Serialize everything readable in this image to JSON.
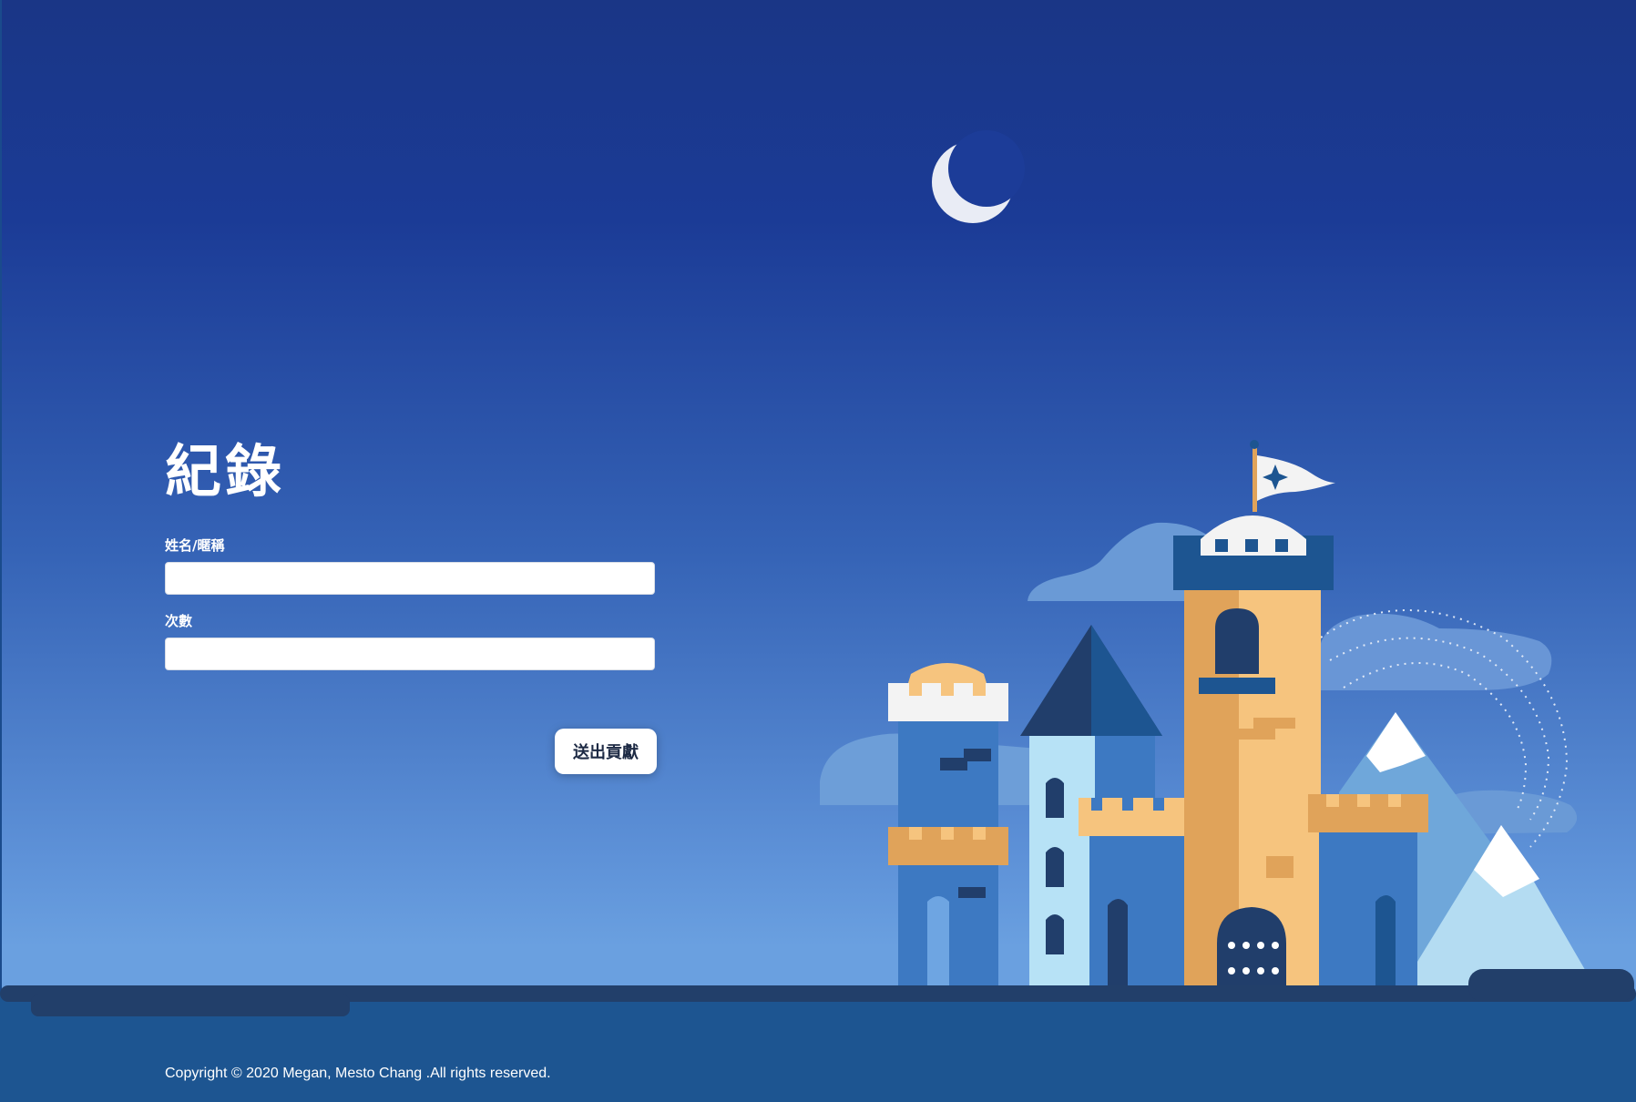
{
  "page": {
    "title": "紀錄"
  },
  "form": {
    "name_label": "姓名/暱稱",
    "name_value": "",
    "count_label": "次數",
    "count_value": "",
    "submit_label": "送出貢獻"
  },
  "footer": {
    "copyright": "Copyright © 2020 Megan, Mesto Chang .All rights reserved."
  },
  "colors": {
    "sky_top": "#1a3686",
    "sky_bottom": "#6aa0e0",
    "ground": "#1d5591",
    "ground_edge": "#223f6a",
    "tower_orange": "#f6c47e",
    "tower_blue": "#3d79c2",
    "roof_dark": "#213e6b"
  },
  "illustration": {
    "icons": [
      "moon-icon",
      "flag-icon",
      "castle-illustration",
      "mountain-icon",
      "cloud-icon"
    ]
  }
}
